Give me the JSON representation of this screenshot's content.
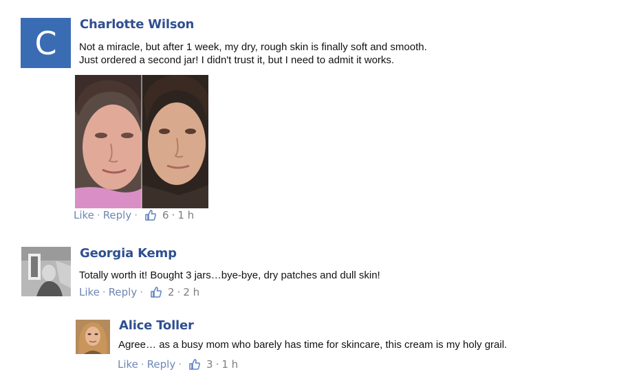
{
  "comments": [
    {
      "author": "Charlotte Wilson",
      "avatar_letter": "C",
      "avatar_color": "#3a6cb4",
      "text_lines": [
        "Not a miracle, but after 1 week, my dry, rough skin is finally soft and smooth.",
        "Just ordered a second jar! I didn't trust it, but I need to admit it works."
      ],
      "like_label": "Like",
      "reply_label": "Reply",
      "like_count": "6",
      "time": "1 h",
      "photo": "before-after-face-photo"
    },
    {
      "author": "Georgia Kemp",
      "avatar": "grayscale-photo-avatar",
      "text_lines": [
        "Totally worth it! Bought 3 jars…bye-bye, dry patches and dull skin!"
      ],
      "like_label": "Like",
      "reply_label": "Reply",
      "like_count": "2",
      "time": "2 h"
    },
    {
      "author": "Alice Toller",
      "avatar": "woman-photo-avatar",
      "text_lines": [
        "Agree… as a busy mom who barely has time for skincare, this cream is my holy grail."
      ],
      "like_label": "Like",
      "reply_label": "Reply",
      "like_count": "3",
      "time": "1 h"
    }
  ],
  "colors": {
    "name": "#2f4f90",
    "action_link": "#6d86b4",
    "meta": "#7d7d7d"
  },
  "icons": {
    "like": "thumbs-up-icon"
  }
}
